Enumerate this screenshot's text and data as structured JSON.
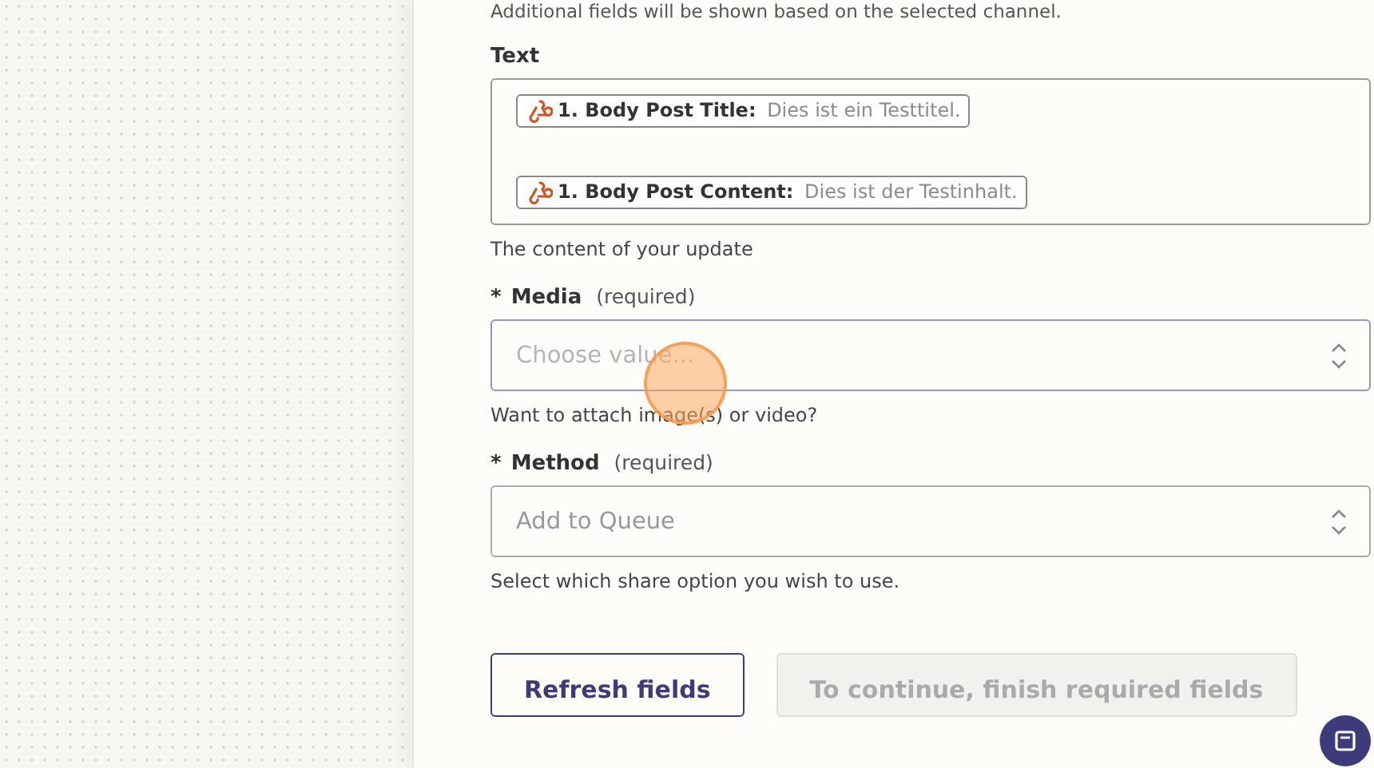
{
  "panel": {
    "intro": "Additional fields will be shown based on the selected channel.",
    "fields": [
      {
        "kind": "tokens",
        "label": "Text",
        "tokens": [
          {
            "name": "1. Body Post Title:",
            "value": "Dies ist ein Testtitel."
          },
          {
            "name": "1. Body Post Content:",
            "value": "Dies ist der Testinhalt."
          }
        ],
        "help": "The content of your update"
      },
      {
        "kind": "select",
        "label": "Media",
        "required": true,
        "required_mark": "*",
        "required_note": "(required)",
        "placeholder": "Choose value...",
        "focused": true,
        "help": "Want to attach image(s) or video?"
      },
      {
        "kind": "select",
        "label": "Method",
        "required": true,
        "required_mark": "*",
        "required_note": "(required)",
        "placeholder": "Add to Queue",
        "focused": false,
        "help": "Select which share option you wish to use."
      }
    ],
    "buttons": [
      {
        "label": "Refresh fields",
        "disabled": false
      },
      {
        "label": "To continue, finish required fields",
        "disabled": true
      }
    ]
  },
  "cursor_highlight": true,
  "chat_button": true
}
